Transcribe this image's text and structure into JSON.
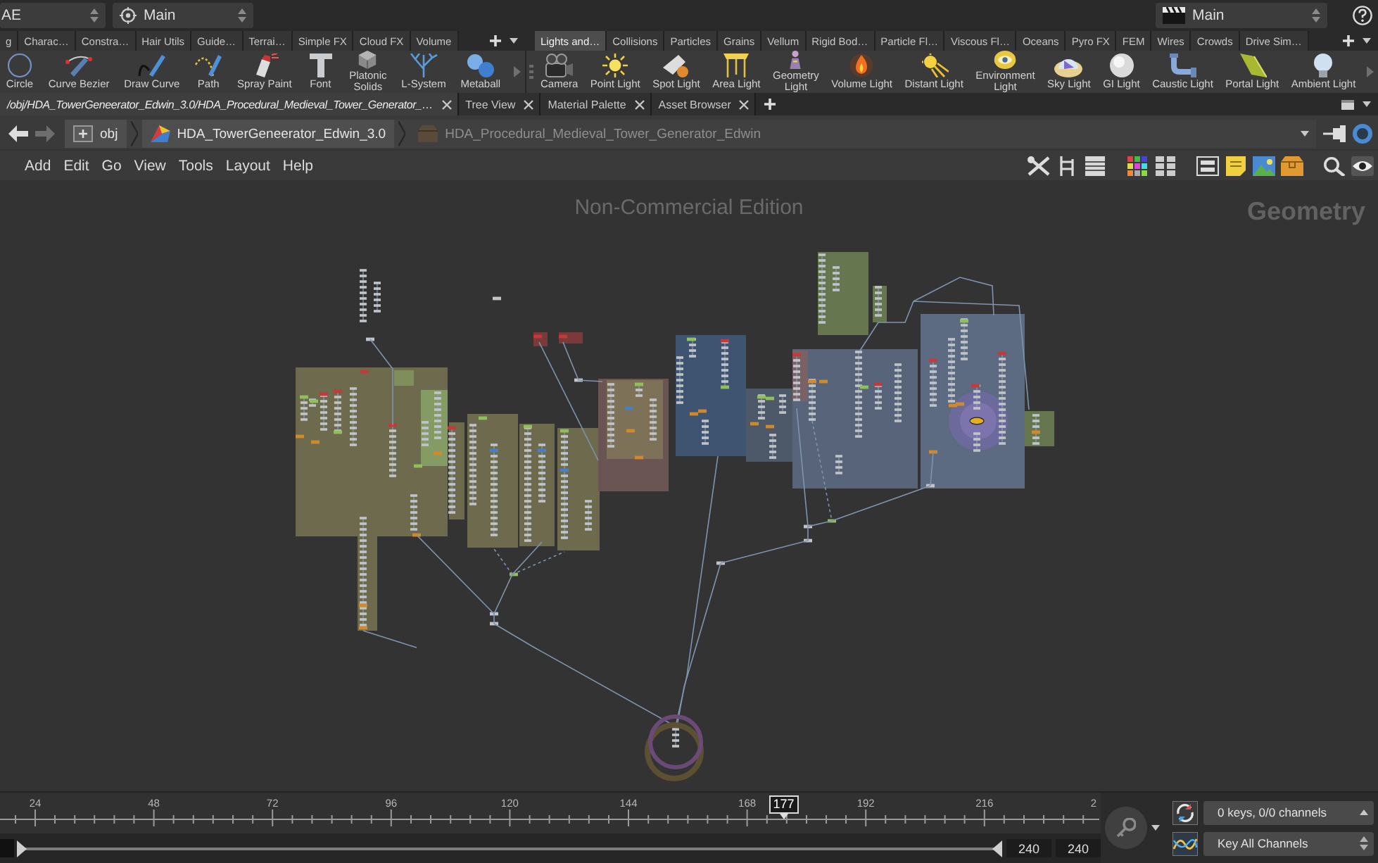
{
  "desktop_bar": {
    "desktop": "AE",
    "context": "Main",
    "viewer": "Main"
  },
  "shelf_sets": [
    {
      "tabs": [
        {
          "label": "g",
          "selected": false
        },
        {
          "label": "Charac…",
          "selected": false
        },
        {
          "label": "Constra…",
          "selected": false
        },
        {
          "label": "Hair Utils",
          "selected": false
        },
        {
          "label": "Guide…",
          "selected": false
        },
        {
          "label": "Terrai…",
          "selected": false
        },
        {
          "label": "Simple FX",
          "selected": false
        },
        {
          "label": "Cloud FX",
          "selected": false
        },
        {
          "label": "Volume",
          "selected": false
        }
      ],
      "tools": [
        "Circle",
        "Curve Bezier",
        "Draw Curve",
        "Path",
        "Spray Paint",
        "Font",
        "Platonic Solids",
        "L-System",
        "Metaball"
      ]
    },
    {
      "tabs": [
        {
          "label": "Lights and…",
          "selected": true
        },
        {
          "label": "Collisions",
          "selected": false
        },
        {
          "label": "Particles",
          "selected": false
        },
        {
          "label": "Grains",
          "selected": false
        },
        {
          "label": "Vellum",
          "selected": false
        },
        {
          "label": "Rigid Bod…",
          "selected": false
        },
        {
          "label": "Particle Fl…",
          "selected": false
        },
        {
          "label": "Viscous Fl…",
          "selected": false
        },
        {
          "label": "Oceans",
          "selected": false
        },
        {
          "label": "Pyro FX",
          "selected": false
        },
        {
          "label": "FEM",
          "selected": false
        },
        {
          "label": "Wires",
          "selected": false
        },
        {
          "label": "Crowds",
          "selected": false
        },
        {
          "label": "Drive Sim…",
          "selected": false
        }
      ],
      "tools": [
        "Camera",
        "Point Light",
        "Spot Light",
        "Area Light",
        "Geometry Light",
        "Volume Light",
        "Distant Light",
        "Environment Light",
        "Sky Light",
        "GI Light",
        "Caustic Light",
        "Portal Light",
        "Ambient Light"
      ]
    }
  ],
  "pane_tabs": [
    {
      "label": "/obj/HDA_TowerGeneerator_Edwin_3.0/HDA_Procedural_Medieval_Tower_Generator_…",
      "selected": true
    },
    {
      "label": "Tree View",
      "selected": false
    },
    {
      "label": "Material Palette",
      "selected": false
    },
    {
      "label": "Asset Browser",
      "selected": false
    }
  ],
  "path": [
    {
      "label": "obj",
      "dimmed": false
    },
    {
      "label": "HDA_TowerGeneerator_Edwin_3.0",
      "dimmed": false
    },
    {
      "label": "HDA_Procedural_Medieval_Tower_Generator_Edwin",
      "dimmed": true
    }
  ],
  "menu": [
    "Add",
    "Edit",
    "Go",
    "View",
    "Tools",
    "Layout",
    "Help"
  ],
  "network_editor": {
    "watermark": "Non-Commercial Edition",
    "context": "Geometry",
    "network_boxes": [
      {
        "color": "#6d6a4e"
      },
      {
        "color": "#7f8f5b"
      },
      {
        "color": "#849c63"
      },
      {
        "color": "#6d6a4e"
      },
      {
        "color": "#6d6a4e"
      },
      {
        "color": "#6d6a4e"
      },
      {
        "color": "#6d6a4e"
      },
      {
        "color": "#6d6a4e"
      },
      {
        "color": "#6a5454"
      },
      {
        "color": "#7d7258"
      },
      {
        "color": "#7b3a3a"
      },
      {
        "color": "#7b3a3a"
      },
      {
        "color": "#3e5470"
      },
      {
        "color": "#4d5868"
      },
      {
        "color": "#58647a"
      },
      {
        "color": "#7a6166"
      },
      {
        "color": "#5c6a82"
      },
      {
        "color": "#66764f"
      },
      {
        "color": "#66764f"
      },
      {
        "color": "#66764f"
      }
    ]
  },
  "timeline": {
    "ruler_labels": [
      "24",
      "48",
      "72",
      "96",
      "120",
      "144",
      "168",
      "192",
      "216",
      "2"
    ],
    "playhead": {
      "frame": "177",
      "level": 0.712
    },
    "range": {
      "level": 1
    },
    "end_frame": "240",
    "global_end_frame": "240",
    "key_status": "0 keys, 0/0 channels",
    "key_mode": "Key All Channels"
  }
}
